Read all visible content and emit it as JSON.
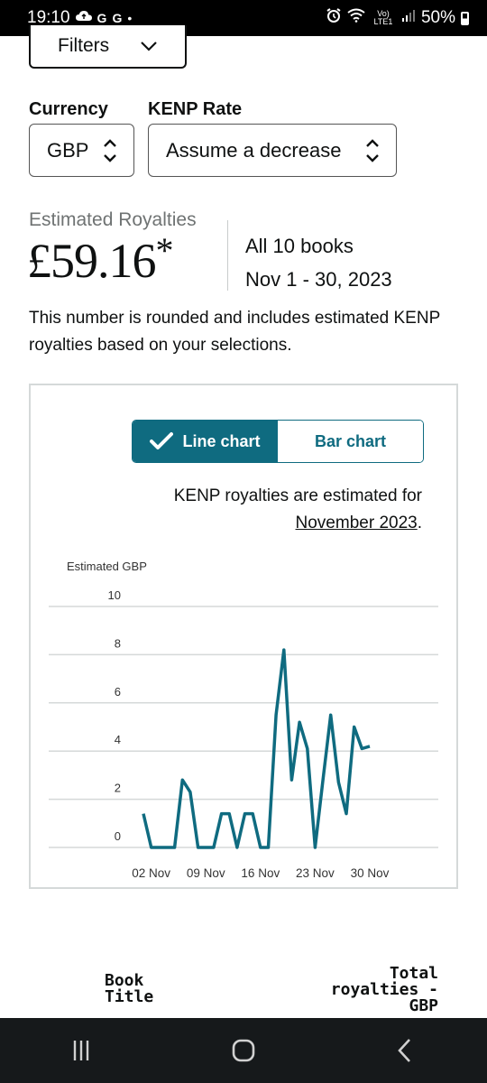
{
  "status_bar": {
    "time": "19:10",
    "notif_icons": [
      "cloud-sync-icon",
      "google-icon",
      "google-icon"
    ],
    "g1": "G",
    "g2": "G",
    "dot": "•",
    "battery": "50%",
    "net_label": "Vo) LTE1"
  },
  "filters": {
    "label": "Filters"
  },
  "currency": {
    "label": "Currency",
    "value": "GBP"
  },
  "kenp_rate": {
    "label": "KENP Rate",
    "value": "Assume a decrease"
  },
  "royalties": {
    "label": "Estimated Royalties",
    "value": "£59.16",
    "asterisk": "*",
    "books": "All 10 books",
    "range": "Nov 1 - 30, 2023",
    "note": "This number is rounded and includes estimated KENP royalties based on your selections."
  },
  "chart_toggle": {
    "line": "Line chart",
    "bar": "Bar chart",
    "active": "line"
  },
  "kenp_note": {
    "prefix": "KENP royalties are estimated for",
    "link": "November 2023",
    "suffix": "."
  },
  "chart_data": {
    "type": "line",
    "ylabel": "Estimated GBP",
    "ylim": [
      0,
      10
    ],
    "yticks": [
      0,
      2,
      4,
      6,
      8,
      10
    ],
    "xtick_labels": [
      "02 Nov",
      "09 Nov",
      "16 Nov",
      "23 Nov",
      "30 Nov"
    ],
    "xtick_days": [
      2,
      9,
      16,
      23,
      30
    ],
    "grid": true,
    "line_color": "#0f6b80",
    "series": [
      {
        "x": [
          1,
          2,
          3,
          4,
          5,
          6,
          7,
          8,
          9,
          10,
          11,
          12,
          13,
          14,
          15,
          16,
          17,
          18,
          19,
          20,
          21,
          22,
          23,
          24,
          25,
          26,
          27,
          28,
          29,
          30
        ],
        "values": [
          1.4,
          0,
          0,
          0,
          0,
          2.8,
          2.3,
          0,
          0,
          0,
          1.4,
          1.4,
          0,
          1.4,
          1.4,
          0,
          0,
          5.5,
          8.2,
          2.8,
          5.2,
          4.1,
          0,
          2.8,
          5.5,
          2.7,
          1.4,
          5,
          4.1,
          4.2
        ]
      }
    ]
  },
  "table_header": {
    "col1": "Book Title",
    "col2": "Total royalties - GBP"
  },
  "nav": {
    "icons": [
      "recents-icon",
      "home-icon",
      "back-icon"
    ]
  }
}
